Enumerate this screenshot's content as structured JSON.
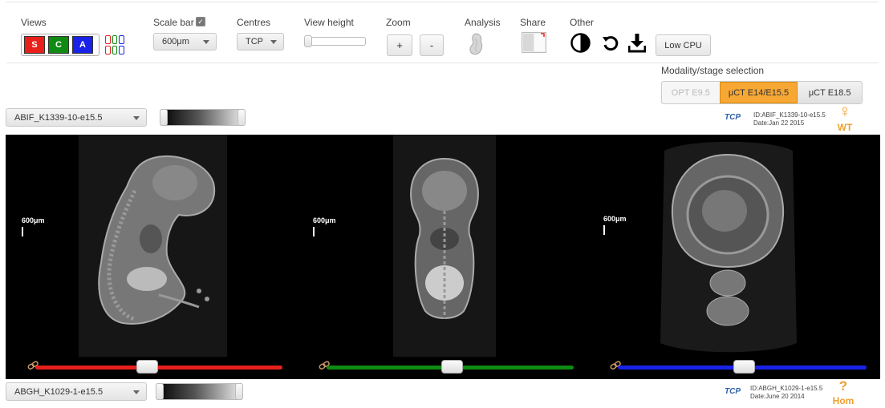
{
  "toolbar": {
    "views": {
      "label": "Views",
      "buttons": [
        "S",
        "C",
        "A"
      ]
    },
    "scale_bar": {
      "label": "Scale bar",
      "checkbox": "✓",
      "selected": "600μm"
    },
    "centres": {
      "label": "Centres",
      "selected": "TCP"
    },
    "view_height": {
      "label": "View height"
    },
    "zoom": {
      "label": "Zoom",
      "in": "+",
      "out": "-"
    },
    "analysis": {
      "label": "Analysis",
      "icon": "embryo-icon"
    },
    "share": {
      "label": "Share",
      "icon": "share-icon"
    },
    "other": {
      "label": "Other",
      "low_cpu": "Low CPU",
      "icons": [
        "contrast-icon",
        "reset-icon",
        "download-icon"
      ]
    }
  },
  "modality": {
    "label": "Modality/stage selection",
    "options": [
      "OPT E9.5",
      "μCT E14/E15.5",
      "μCT E18.5"
    ],
    "selected_index": 1
  },
  "specimens": {
    "top": {
      "name": "ABIF_K1339-10-e15.5",
      "logo": "TCP",
      "id_line": "ID:ABIF_K1339-10-e15.5",
      "date_line": "Date:Jan 22 2015",
      "genotype": "WT",
      "sex_symbol": "♀"
    },
    "bottom": {
      "name": "ABGH_K1029-1-e15.5",
      "logo": "TCP",
      "id_line": "ID:ABGH_K1029-1-e15.5",
      "date_line": "Date:June 20 2014",
      "genotype": "Hom",
      "sex_symbol": "?"
    }
  },
  "viewer": {
    "panels": [
      {
        "view": "sagittal",
        "scale_label": "600μm",
        "slider_color": "#e8201c",
        "slider_position": 0.45
      },
      {
        "view": "coronal",
        "scale_label": "600μm",
        "slider_color": "#0f8a12",
        "slider_position": 0.5
      },
      {
        "view": "axial",
        "scale_label": "600μm",
        "slider_color": "#1a22e8",
        "slider_position": 0.5
      }
    ]
  },
  "colors": {
    "accent_orange": "#f7a733",
    "sagittal": "#e8201c",
    "coronal": "#0f8a12",
    "axial": "#1a22e8"
  }
}
